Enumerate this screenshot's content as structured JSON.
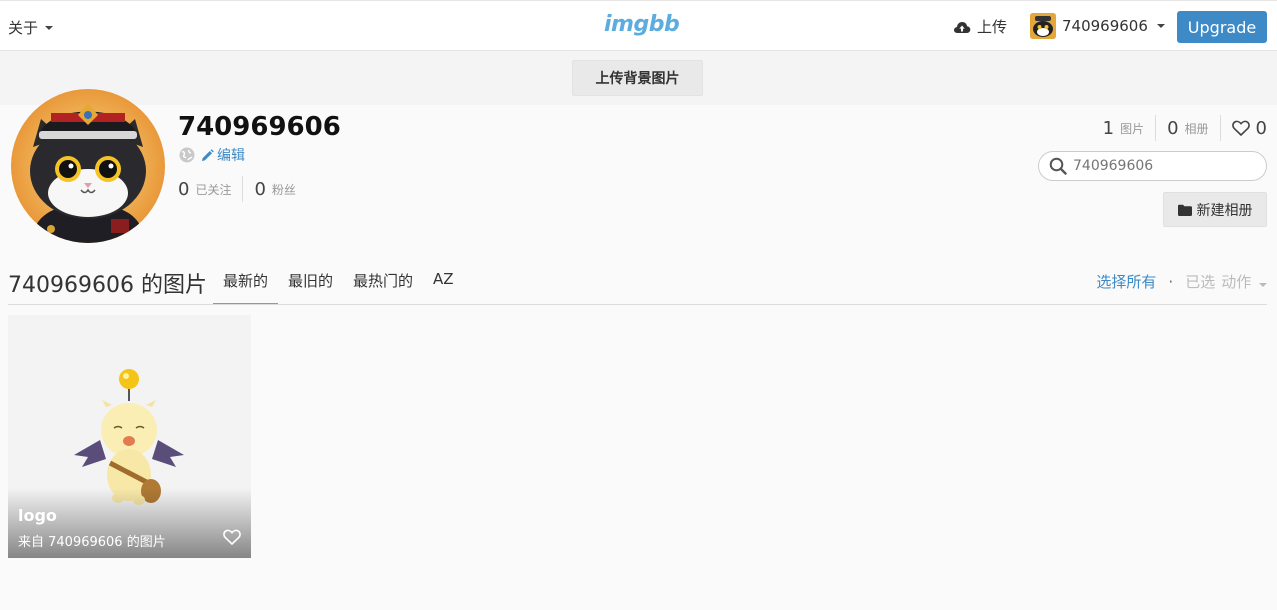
{
  "topbar": {
    "about_label": "关于",
    "logo_text": "imgbb",
    "upload_label": "上传",
    "username": "740969606",
    "upgrade_label": "Upgrade"
  },
  "cover": {
    "upload_bg_label": "上传背景图片"
  },
  "profile": {
    "username": "740969606",
    "edit_label": "编辑",
    "following_count": "0",
    "following_label": "已关注",
    "followers_count": "0",
    "followers_label": "粉丝"
  },
  "stats": {
    "images_count": "1",
    "images_label": "图片",
    "albums_count": "0",
    "albums_label": "相册",
    "likes_count": "0"
  },
  "search": {
    "placeholder": "740969606"
  },
  "new_album_label": "新建相册",
  "listing": {
    "title": "740969606 的图片",
    "tabs": [
      "最新的",
      "最旧的",
      "最热门的",
      "AZ"
    ],
    "select_all": "选择所有",
    "selected_label": "已选",
    "action_label": "动作"
  },
  "images": [
    {
      "title": "logo",
      "subtitle": "来自 740969606 的图片"
    }
  ],
  "colors": {
    "accent": "#3d8ac7",
    "logo": "#5cacdf",
    "tab_underline": "#5aa9d6"
  }
}
